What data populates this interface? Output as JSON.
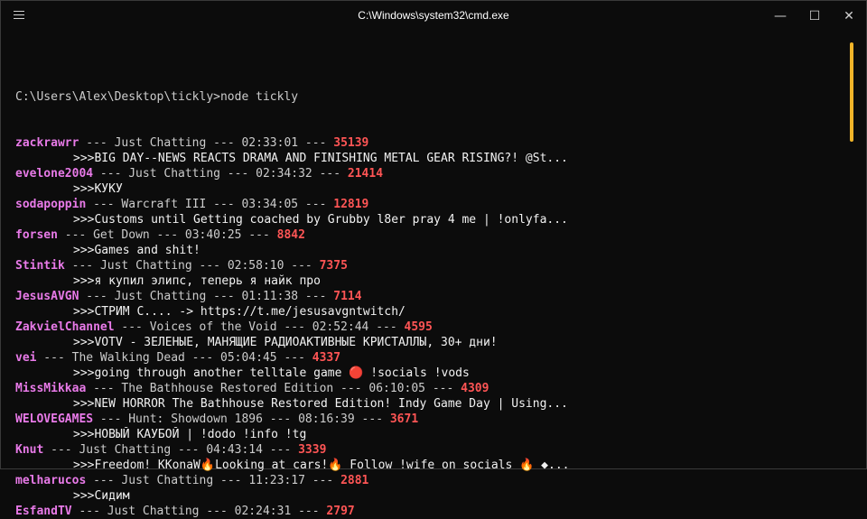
{
  "window": {
    "title": "C:\\Windows\\system32\\cmd.exe",
    "minimize_glyph": "—",
    "maximize_glyph": "☐",
    "close_glyph": "✕"
  },
  "console": {
    "prompt": "C:\\Users\\Alex\\Desktop\\tickly>",
    "command": "node tickly",
    "separator": " --- ",
    "message_prefix": ">>>",
    "streams": [
      {
        "user": "zackrawrr",
        "category": "Just Chatting",
        "uptime": "02:33:01",
        "viewers": "35139",
        "message": "BIG DAY--NEWS REACTS DRAMA AND FINISHING METAL GEAR RISING?! @St..."
      },
      {
        "user": "evelone2004",
        "category": "Just Chatting",
        "uptime": "02:34:32",
        "viewers": "21414",
        "message": "КУКУ"
      },
      {
        "user": "sodapoppin",
        "category": "Warcraft III",
        "uptime": "03:34:05",
        "viewers": "12819",
        "message": "Customs until Getting coached by Grubby l8er pray 4 me | !onlyfa..."
      },
      {
        "user": "forsen",
        "category": "Get Down",
        "uptime": "03:40:25",
        "viewers": "8842",
        "message": "Games and shit!"
      },
      {
        "user": "Stintik",
        "category": "Just Chatting",
        "uptime": "02:58:10",
        "viewers": "7375",
        "message": "я купил элипс, теперь я найк про"
      },
      {
        "user": "JesusAVGN",
        "category": "Just Chatting",
        "uptime": "01:11:38",
        "viewers": "7114",
        "message": "СТРИМ С.... -> https://t.me/jesusavgntwitch/"
      },
      {
        "user": "ZakvielChannel",
        "category": "Voices of the Void",
        "uptime": "02:52:44",
        "viewers": "4595",
        "message": "VOTV - ЗЕЛЕНЫЕ, МАНЯЩИЕ РАДИОАКТИВНЫЕ КРИСТАЛЛЫ, 30+ дни!"
      },
      {
        "user": "vei",
        "category": "The Walking Dead",
        "uptime": "05:04:45",
        "viewers": "4337",
        "message": "going through another telltale game 🔴 !socials !vods"
      },
      {
        "user": "MissMikkaa",
        "category": "The Bathhouse Restored Edition",
        "uptime": "06:10:05",
        "viewers": "4309",
        "message": "NEW HORROR The Bathhouse Restored Edition! Indy Game Day | Using..."
      },
      {
        "user": "WELOVEGAMES",
        "category": "Hunt: Showdown 1896",
        "uptime": "08:16:39",
        "viewers": "3671",
        "message": "НОВЫЙ КАУБОЙ | !dodo !info !tg"
      },
      {
        "user": "Knut",
        "category": "Just Chatting",
        "uptime": "04:43:14",
        "viewers": "3339",
        "message": "Freedom! KKonaW🔥Looking at cars!🔥 Follow !wife on socials 🔥 ◆..."
      },
      {
        "user": "melharucos",
        "category": "Just Chatting",
        "uptime": "11:23:17",
        "viewers": "2881",
        "message": "Сидим"
      },
      {
        "user": "EsfandTV",
        "category": "Just Chatting",
        "uptime": "02:24:31",
        "viewers": "2797",
        "message": ""
      }
    ]
  },
  "colors": {
    "username": "#e87ae8",
    "viewers": "#ff5555",
    "scrollbar_thumb": "#f0b429"
  }
}
